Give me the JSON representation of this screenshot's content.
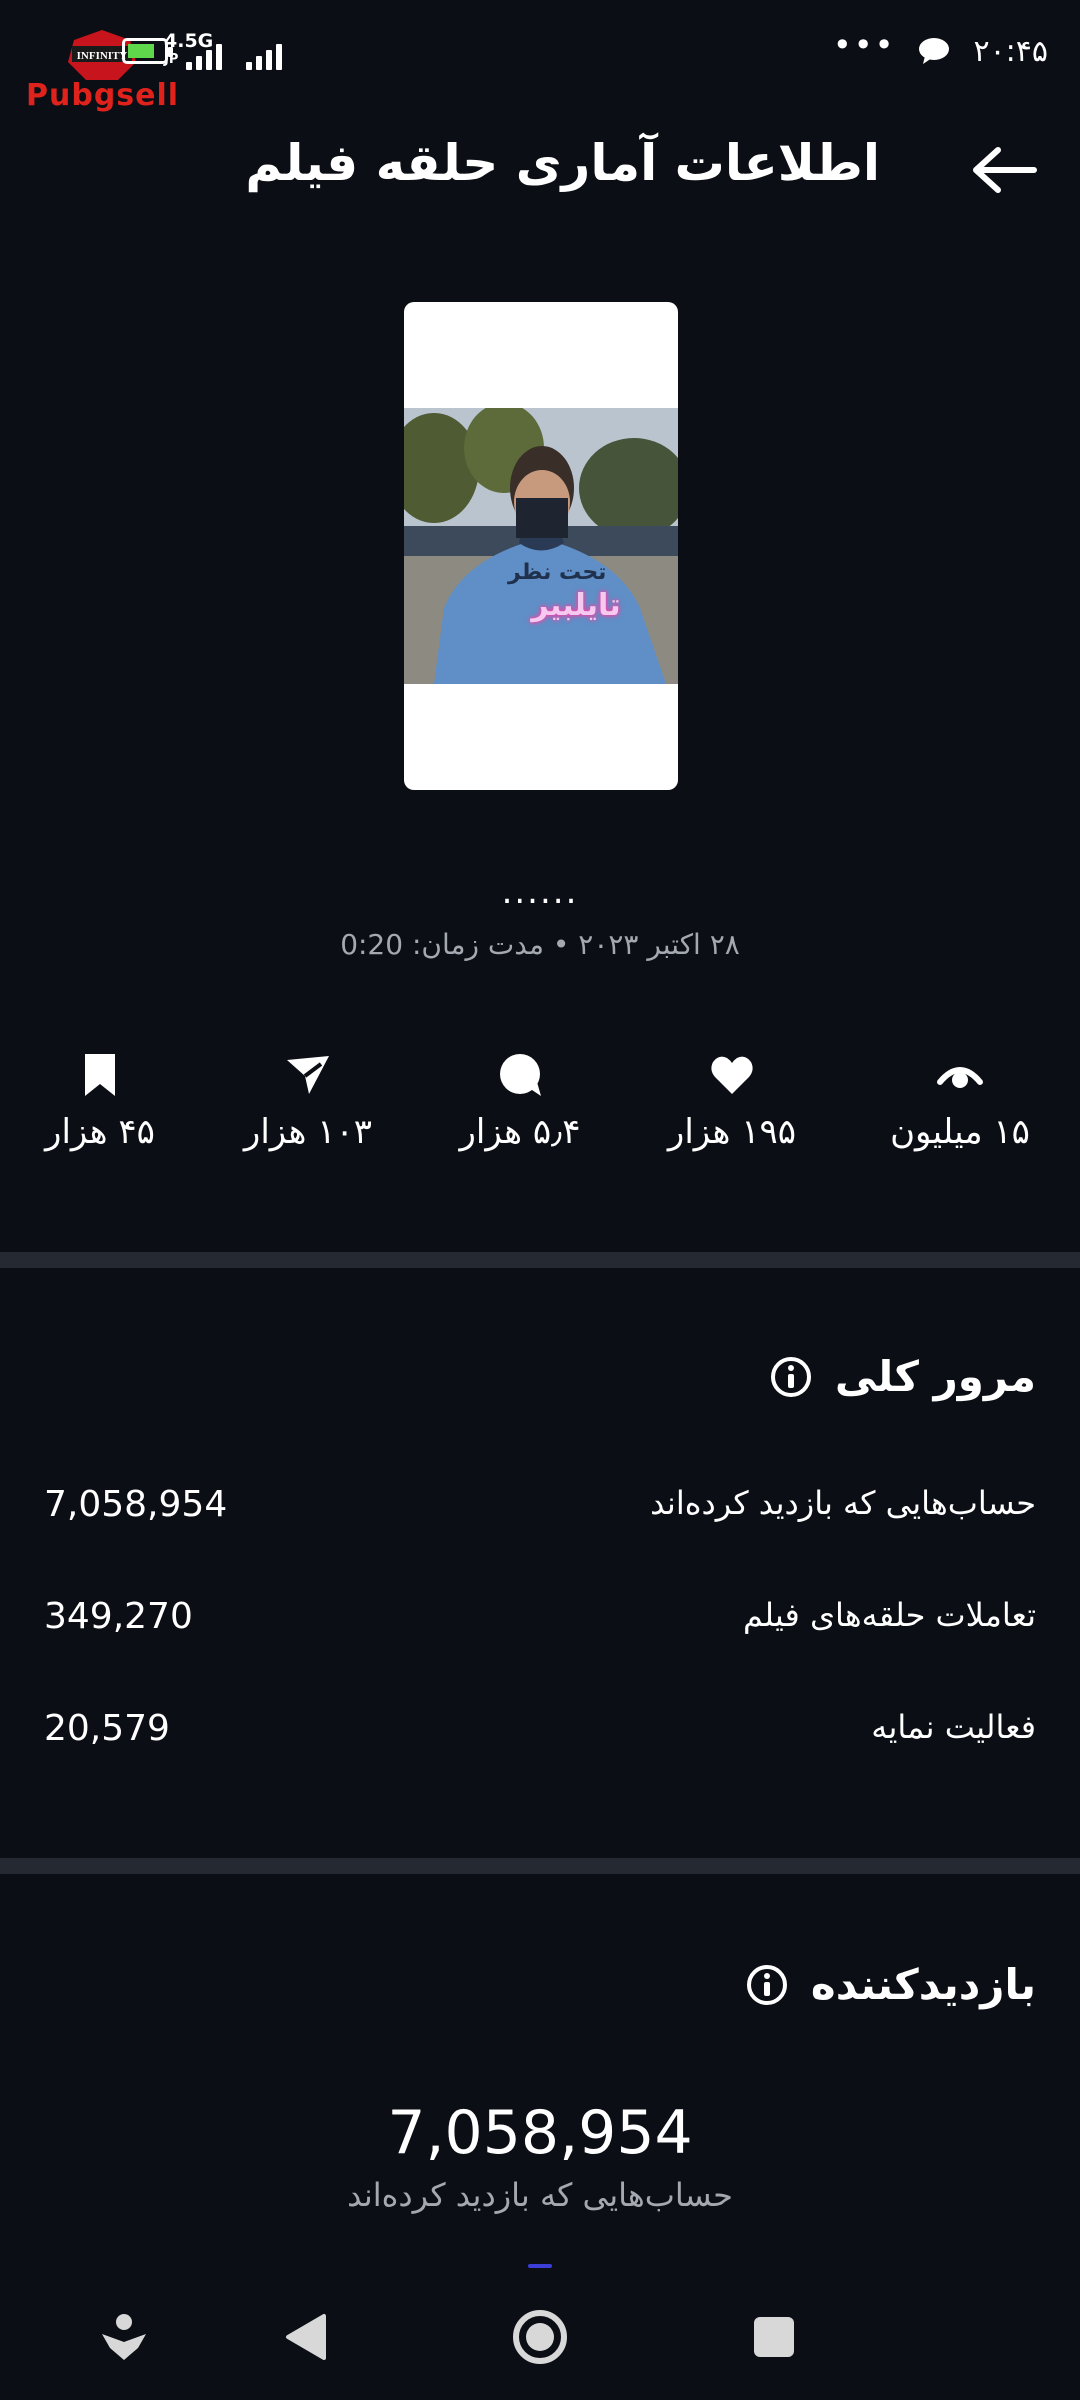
{
  "status_bar": {
    "time": "۲۰:۴۵",
    "network_type": "4.5G",
    "network_sub": "JP",
    "overflow_dots": "•••",
    "watermark_brand": "Pubgsell",
    "watermark_badge": "INFINITY"
  },
  "header": {
    "title": "اطلاعات آماری حلقه فیلم"
  },
  "reel": {
    "thumbnail_overlay_text": "تایلبیر",
    "thumbnail_overlay_text_top": "تحت نظر",
    "caption": "......",
    "meta": "۲۸ اکتبر ۲۰۲۳ • مدت زمان: 0:20"
  },
  "stats": {
    "views": "۱۵ میلیون",
    "likes": "۱۹۵ هزار",
    "comments": "۵٫۴ هزار",
    "shares": "۱۰۳ هزار",
    "saves": "۴۵ هزار"
  },
  "overview": {
    "title": "مرور کلی",
    "rows": [
      {
        "label": "حساب‌هایی که بازدید کرده‌اند",
        "value": "7,058,954"
      },
      {
        "label": "تعاملات حلقه‌های فیلم",
        "value": "349,270"
      },
      {
        "label": "فعالیت نمایه",
        "value": "20,579"
      }
    ]
  },
  "viewers": {
    "title": "بازدیدکننده",
    "total": "7,058,954",
    "total_label": "حساب‌هایی که بازدید کرده‌اند"
  },
  "colors": {
    "background": "#0b0e14",
    "divider": "#252932",
    "muted_text": "#a3a8b1"
  }
}
